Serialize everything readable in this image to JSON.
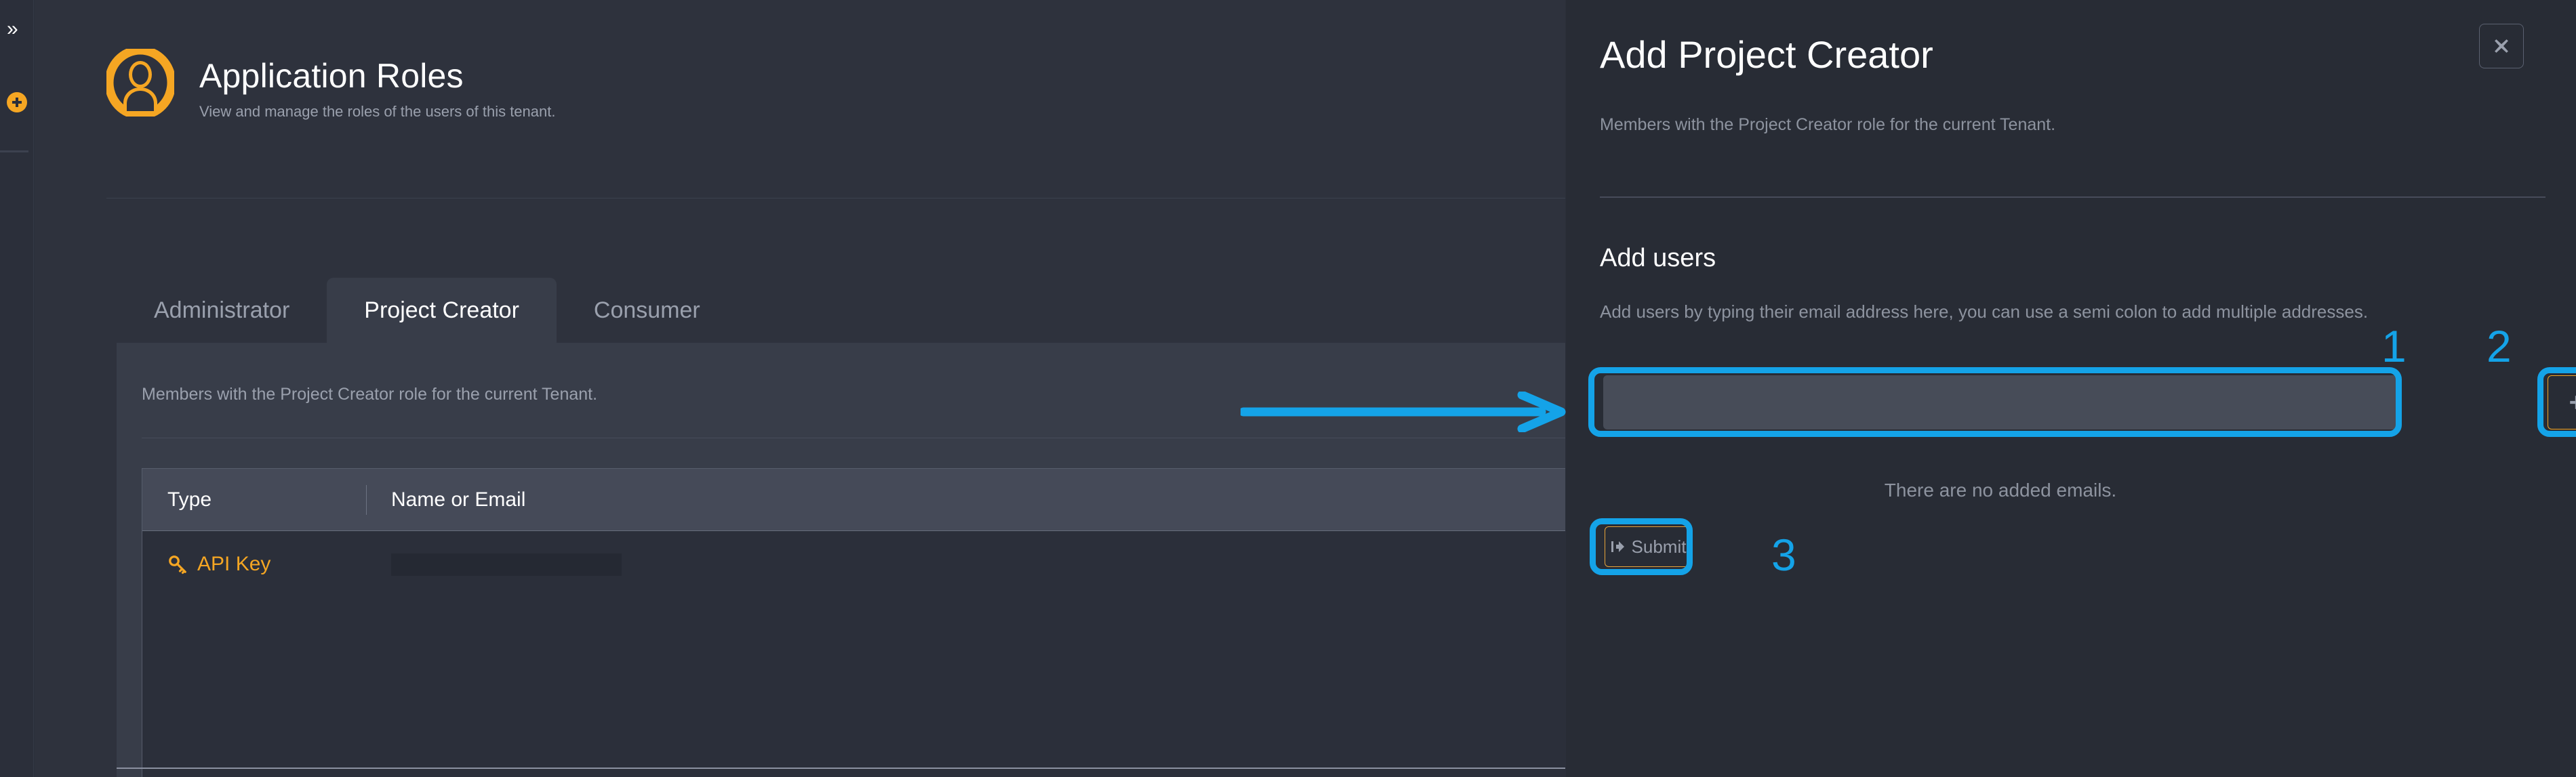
{
  "rail": {
    "collapse_icon": "chevron-double-right-icon",
    "collapse_glyph": "»",
    "add_icon": "circle-plus-icon"
  },
  "page": {
    "icon": "user-avatar-icon",
    "title": "Application Roles",
    "subtitle": "View and manage the roles of the users of this tenant."
  },
  "tabs": [
    {
      "label": "Administrator",
      "active": false
    },
    {
      "label": "Project Creator",
      "active": true
    },
    {
      "label": "Consumer",
      "active": false
    }
  ],
  "tabpanel": {
    "description": "Members with the Project Creator role for the current Tenant.",
    "table": {
      "columns": [
        "Type",
        "Name or Email"
      ],
      "rows": [
        {
          "type": "API Key",
          "type_icon": "key-icon",
          "name_or_email": ""
        }
      ]
    }
  },
  "panel": {
    "title": "Add Project Creator",
    "subtitle": "Members with the Project Creator role for the current Tenant.",
    "close_icon": "close-icon",
    "close_glyph": "✖",
    "section_title": "Add users",
    "hint": "Add users by typing their email address here, you can use a semi colon to add multiple addresses.",
    "email_input_value": "",
    "email_input_placeholder": "",
    "add_button_icon": "plus-icon",
    "empty_state": "There are no added emails.",
    "submit_label": "Submit",
    "submit_icon": "arrow-right-icon"
  },
  "annotations": {
    "highlight_color": "#14a3e8",
    "accent_color": "#f5a623",
    "markers": [
      {
        "number": "1",
        "target": "email-input"
      },
      {
        "number": "2",
        "target": "add-email-button"
      },
      {
        "number": "3",
        "target": "submit-button"
      }
    ],
    "arrow": {
      "from": "table-area",
      "to": "email-input"
    }
  }
}
